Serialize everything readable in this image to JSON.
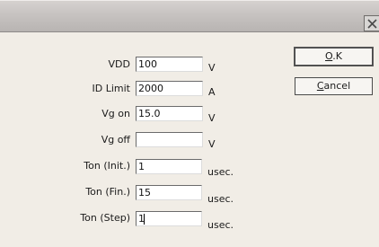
{
  "titlebar": {
    "close_glyph": "✕",
    "close_icon": "close-icon"
  },
  "fields": [
    {
      "id": "vdd",
      "label": "VDD",
      "value": "100",
      "unit": "V"
    },
    {
      "id": "id-limit",
      "label": "ID Limit",
      "value": "2000",
      "unit": "A"
    },
    {
      "id": "vg-on",
      "label": "Vg on",
      "value": "15.0",
      "unit": "V"
    },
    {
      "id": "vg-off",
      "label": "Vg off",
      "value": "",
      "unit": "V"
    },
    {
      "id": "ton-init",
      "label": "Ton (Init.)",
      "value": "1",
      "unit": "usec."
    },
    {
      "id": "ton-fin",
      "label": "Ton (Fin.)",
      "value": "15",
      "unit": "usec."
    },
    {
      "id": "ton-step",
      "label": "Ton (Step)",
      "value": "1",
      "unit": "usec."
    }
  ],
  "buttons": {
    "ok": {
      "mnemonic": "O",
      "rest": ".K"
    },
    "cancel": {
      "mnemonic": "C",
      "rest": "ancel"
    }
  }
}
